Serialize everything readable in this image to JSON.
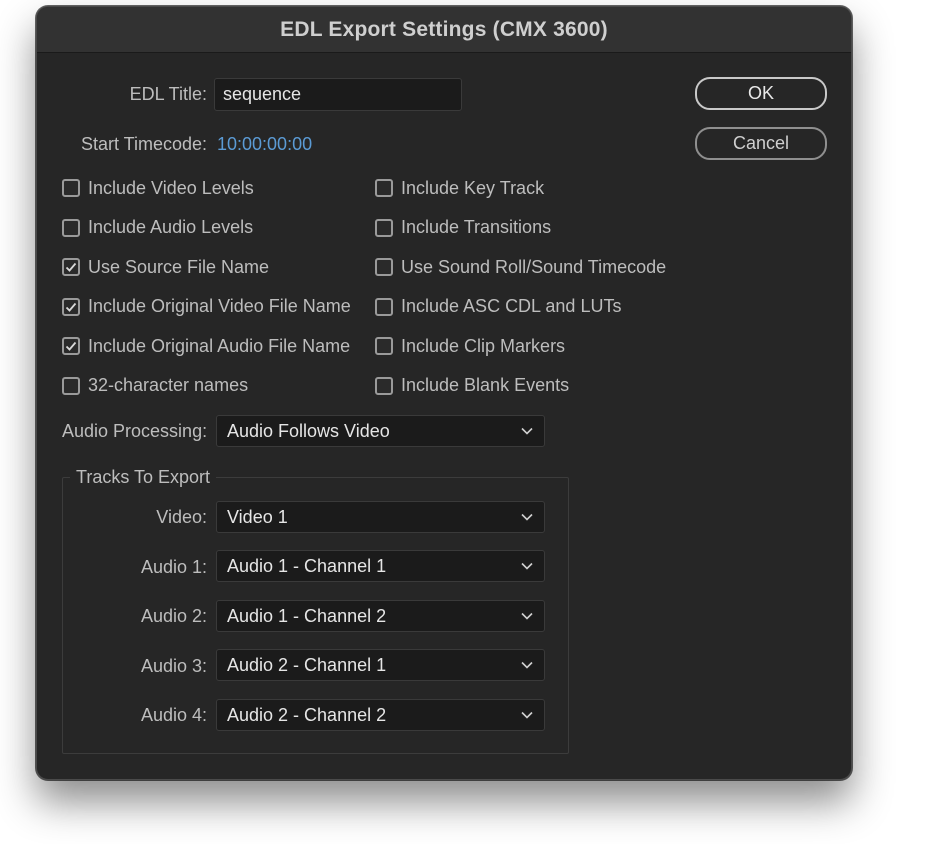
{
  "dialog": {
    "title": "EDL Export Settings (CMX 3600)"
  },
  "fields": {
    "edl_title_label": "EDL Title:",
    "edl_title_value": "sequence",
    "start_timecode_label": "Start Timecode:",
    "start_timecode_value": "10:00:00:00"
  },
  "buttons": {
    "ok": "OK",
    "cancel": "Cancel"
  },
  "checkboxes_left": [
    {
      "label": "Include Video Levels",
      "checked": false
    },
    {
      "label": "Include Audio Levels",
      "checked": false
    },
    {
      "label": "Use Source File Name",
      "checked": true
    },
    {
      "label": "Include Original Video File Name",
      "checked": true
    },
    {
      "label": "Include Original Audio File Name",
      "checked": true
    },
    {
      "label": "32-character names",
      "checked": false
    }
  ],
  "checkboxes_right": [
    {
      "label": "Include Key Track",
      "checked": false
    },
    {
      "label": "Include Transitions",
      "checked": false
    },
    {
      "label": "Use Sound Roll/Sound Timecode",
      "checked": false
    },
    {
      "label": "Include ASC CDL and LUTs",
      "checked": false
    },
    {
      "label": "Include Clip Markers",
      "checked": false
    },
    {
      "label": "Include Blank Events",
      "checked": false
    }
  ],
  "audio_processing": {
    "label": "Audio Processing:",
    "value": "Audio Follows Video"
  },
  "tracks": {
    "legend": "Tracks To Export",
    "video": {
      "label": "Video:",
      "value": "Video 1"
    },
    "audio1": {
      "label": "Audio 1:",
      "value": "Audio 1 - Channel 1"
    },
    "audio2": {
      "label": "Audio 2:",
      "value": "Audio 1 - Channel 2"
    },
    "audio3": {
      "label": "Audio 3:",
      "value": "Audio 2 - Channel 1"
    },
    "audio4": {
      "label": "Audio 4:",
      "value": "Audio 2 - Channel 2"
    }
  },
  "colors": {
    "accent": "#5b9bd5",
    "panel": "#262626",
    "field": "#1b1b1b"
  },
  "icons": {
    "checkmark": "checkmark-icon",
    "dropdown": "chevron-down-icon"
  }
}
